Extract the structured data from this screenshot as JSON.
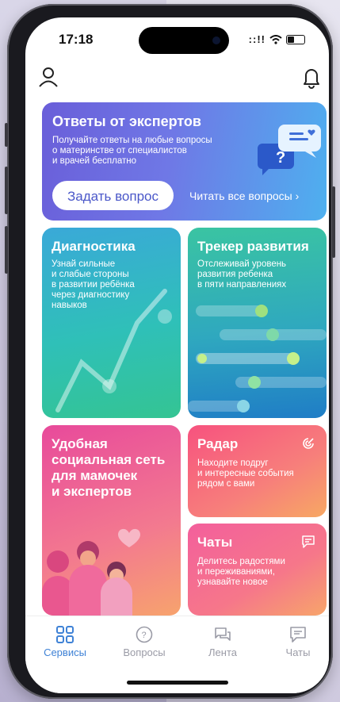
{
  "status": {
    "time": "17:18",
    "signal": "::!!"
  },
  "cards": {
    "experts": {
      "title": "Ответы от экспертов",
      "desc_lines": [
        "Получайте ответы на любые вопросы",
        "о материнстве от специалистов",
        "и врачей бесплатно"
      ],
      "button": "Задать вопрос",
      "link": "Читать все вопросы"
    },
    "diagnostics": {
      "title": "Диагностика",
      "desc_lines": [
        "Узнай сильные",
        "и слабые стороны",
        "в развитии ребёнка",
        "через диагностику",
        "навыков"
      ]
    },
    "tracker": {
      "title": "Трекер развития",
      "desc_lines": [
        "Отслеживай уровень",
        "развития ребенка",
        "в пяти направлениях"
      ]
    },
    "social": {
      "title_lines": [
        "Удобная",
        "социальная сеть",
        "для мамочек",
        "и экспертов"
      ]
    },
    "radar": {
      "title": "Радар",
      "desc_lines": [
        "Находите подруг",
        "и интересные события",
        "рядом с вами"
      ]
    },
    "chats": {
      "title": "Чаты",
      "desc_lines": [
        "Делитесь радостями",
        "и переживаниями,",
        "узнавайте новое"
      ]
    }
  },
  "tabs": [
    {
      "label": "Сервисы",
      "active": true
    },
    {
      "label": "Вопросы",
      "active": false
    },
    {
      "label": "Лента",
      "active": false
    },
    {
      "label": "Чаты",
      "active": false
    }
  ],
  "colors": {
    "accent": "#3f82d6",
    "inactive": "#9a9ba6"
  }
}
